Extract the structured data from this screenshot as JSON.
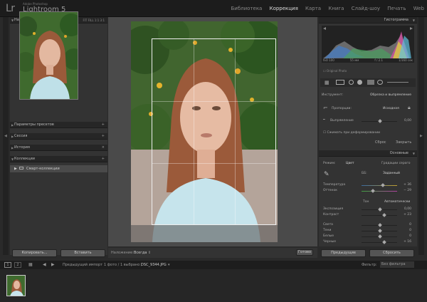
{
  "app": {
    "logo": "Lr",
    "brand_small": "Adobe Photoshop",
    "brand": "Lightroom 5"
  },
  "modules": [
    {
      "label": "Библиотека",
      "active": false
    },
    {
      "label": "Коррекция",
      "active": true
    },
    {
      "label": "Карта",
      "active": false
    },
    {
      "label": "Книга",
      "active": false
    },
    {
      "label": "Слайд-шоу",
      "active": false
    },
    {
      "label": "Печать",
      "active": false
    },
    {
      "label": "Web",
      "active": false
    }
  ],
  "left": {
    "navigator": "Навигатор",
    "nav_opts": "FIT  FILL  1:1  3:1",
    "presets": "Параметры пресетов",
    "snapshots": "Сессия",
    "history": "История",
    "collections": "Коллекции",
    "collection_item": "Смарт-коллекции",
    "copy_btn": "Копировать...",
    "paste_btn": "Вставить"
  },
  "right": {
    "histogram": "Гистограмма",
    "hist_info": [
      "ISO 100",
      "55 мм",
      "f / 2.1",
      "1/160 сек"
    ],
    "original_photo": "Original Photo",
    "tool_label": "Инструмент:",
    "tool_name": "Обрезка и выпрямление",
    "aspect": "Пропорции:",
    "aspect_value": "Исходная",
    "straighten": "Выпрямление",
    "straighten_value": "0,00",
    "constrain": "Сжимать при деформировании",
    "reset": "Сброс",
    "close": "Закрыть",
    "basic": "Основные",
    "treatment": "Режим:",
    "color": "Цвет",
    "bw": "Градации серого",
    "wb": "ББ:",
    "wb_value": "Заданный",
    "temp": "Температура",
    "temp_value": "+ 36",
    "tint": "Оттенок",
    "tint_value": "− 29",
    "tone": "Тон",
    "auto": "Автоматически",
    "exposure": "Экспозиция",
    "exposure_value": "0,00",
    "contrast": "Контраст",
    "contrast_value": "+ 23",
    "highlights": "Света",
    "highlights_value": "0",
    "shadows": "Тени",
    "shadows_value": "0",
    "whites": "Белые",
    "whites_value": "0",
    "blacks": "Черные",
    "blacks_value": "+ 16",
    "prev_btn": "Предыдущие",
    "reset_btn": "Сбросить"
  },
  "toolbar": {
    "overlay_label": "Наложение:",
    "overlay_value": "Всегда",
    "done_btn": "Готово"
  },
  "bottom": {
    "page1": "1",
    "page2": "2",
    "source": "Предыдущий импорт",
    "counts": "1 фото / 1 выбрано /",
    "filename": "DSC_9344.JPG",
    "filter_label": "Фильтр:",
    "filter_value": "Без фильтра"
  },
  "colors": {
    "accent": "#dddddd",
    "panel": "#333333",
    "header": "#262626"
  }
}
